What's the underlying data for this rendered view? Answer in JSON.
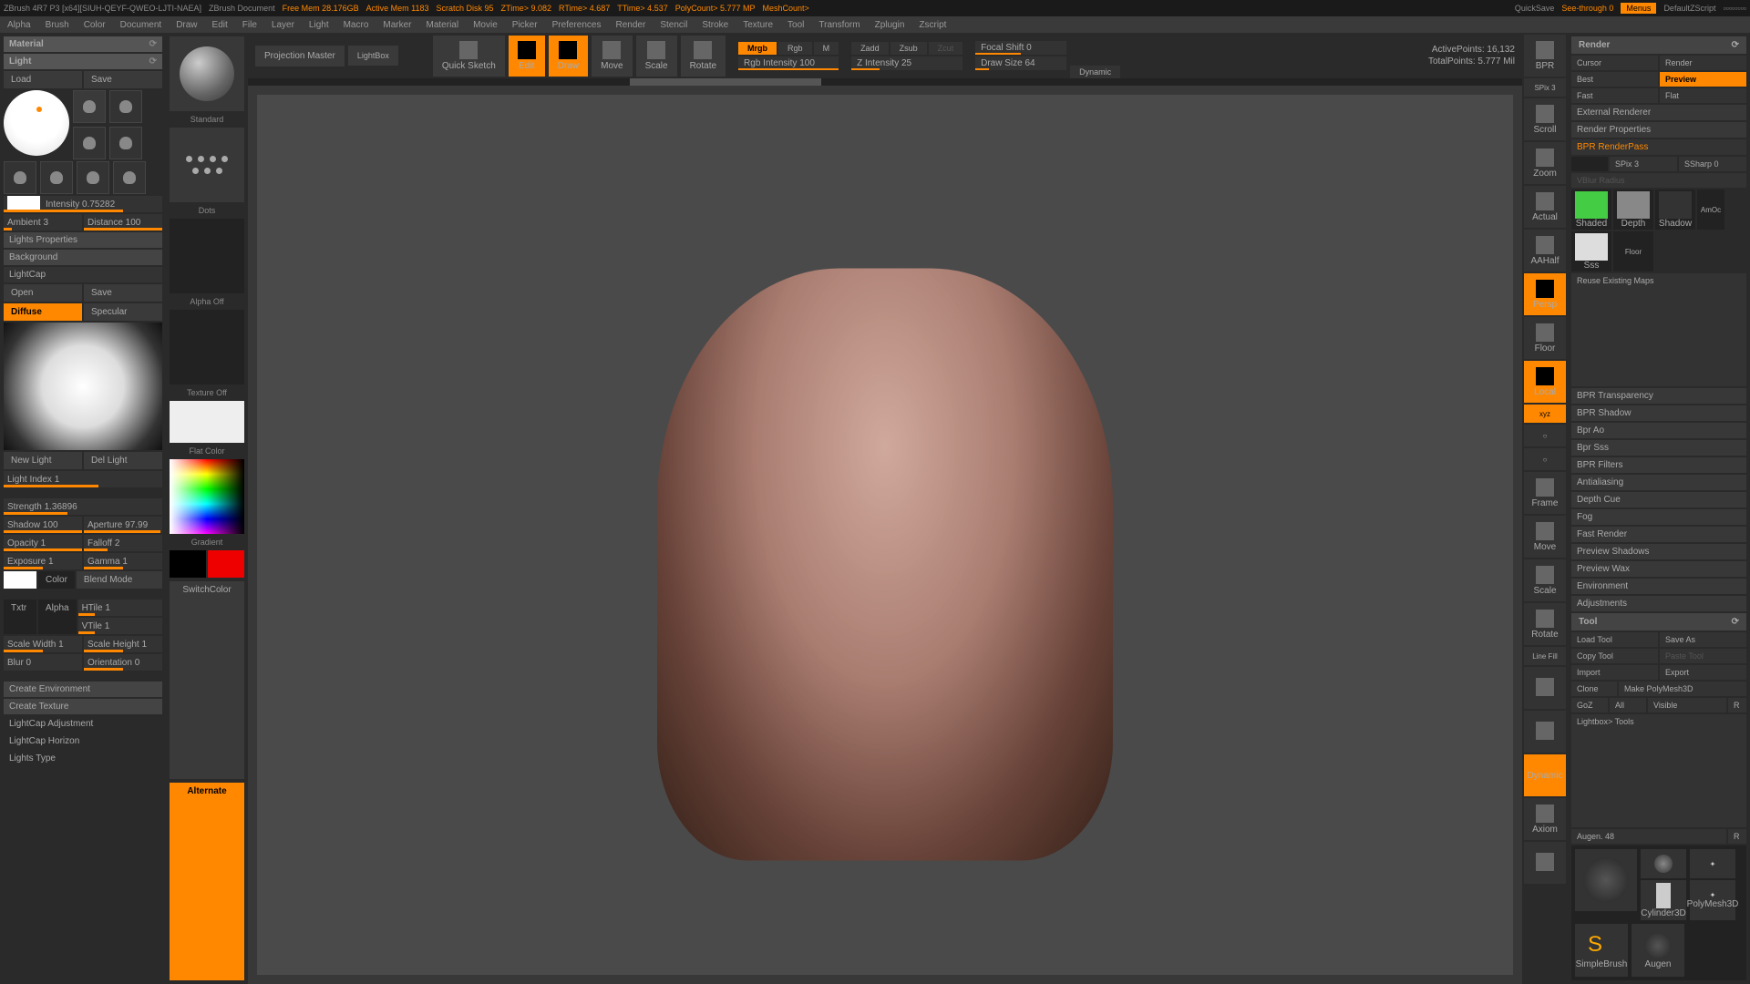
{
  "titlebar": {
    "app": "ZBrush 4R7 P3 [x64][SIUH-QEYF-QWEO-LJTI-NAEA]",
    "doc": "ZBrush Document",
    "freemem": "Free Mem 28.176GB",
    "activemem": "Active Mem 1183",
    "scratch": "Scratch Disk 95",
    "ztime": "ZTime> 9.082",
    "rtime": "RTime> 4.687",
    "ttime": "TTime> 4.537",
    "polycount": "PolyCount> 5.777 MP",
    "meshcount": "MeshCount>",
    "quicksave": "QuickSave",
    "seethrough": "See-through 0",
    "menus": "Menus",
    "script": "DefaultZScript"
  },
  "menubar": [
    "Alpha",
    "Brush",
    "Color",
    "Document",
    "Draw",
    "Edit",
    "File",
    "Layer",
    "Light",
    "Macro",
    "Marker",
    "Material",
    "Movie",
    "Picker",
    "Preferences",
    "Render",
    "Stencil",
    "Stroke",
    "Texture",
    "Tool",
    "Transform",
    "Zplugin",
    "Zscript"
  ],
  "leftpanel": {
    "material": "Material",
    "light": "Light",
    "load": "Load",
    "save": "Save",
    "intensity": "Intensity 0.75282",
    "ambient": "Ambient 3",
    "distance": "Distance 100",
    "lights_props": "Lights Properties",
    "background": "Background",
    "lightcap": "LightCap",
    "open": "Open",
    "save2": "Save",
    "diffuse": "Diffuse",
    "specular": "Specular",
    "newlight": "New Light",
    "dellight": "Del Light",
    "lightindex": "Light Index 1",
    "strength": "Strength 1.36896",
    "shadow": "Shadow 100",
    "aperture": "Aperture 97.99",
    "opacity": "Opacity 1",
    "falloff": "Falloff 2",
    "exposure": "Exposure 1",
    "gamma": "Gamma 1",
    "color": "Color",
    "blendmode": "Blend Mode",
    "htile": "HTile 1",
    "txtr": "Txtr",
    "alpha": "Alpha",
    "vtile": "VTile 1",
    "scalew": "Scale Width 1",
    "scaleh": "Scale Height 1",
    "blur": "Blur 0",
    "orient": "Orientation 0",
    "createenv": "Create Environment",
    "createtex": "Create Texture",
    "lcadjust": "LightCap Adjustment",
    "lchorizon": "LightCap Horizon",
    "lightstype": "Lights Type"
  },
  "toolcol": {
    "standard": "Standard",
    "dots": "Dots",
    "alphaoff": "Alpha Off",
    "textureoff": "Texture Off",
    "flatcolor": "Flat Color",
    "gradient": "Gradient",
    "switchcolor": "SwitchColor",
    "alternate": "Alternate"
  },
  "toolbar": {
    "projmaster": "Projection Master",
    "lightbox": "LightBox",
    "quicksketch": "Quick Sketch",
    "edit": "Edit",
    "draw": "Draw",
    "move": "Move",
    "scale": "Scale",
    "rotate": "Rotate",
    "mrgb": "Mrgb",
    "rgb": "Rgb",
    "m": "M",
    "rgbint": "Rgb Intensity 100",
    "zadd": "Zadd",
    "zsub": "Zsub",
    "zcut": "Zcut",
    "zint": "Z Intensity 25",
    "focalshift": "Focal Shift 0",
    "drawsize": "Draw Size 64",
    "dynamic": "Dynamic",
    "activepoints": "ActivePoints: 16,132",
    "totalpoints": "TotalPoints: 5.777 Mil"
  },
  "righttools": [
    "BPR",
    "SPix 3",
    "",
    "Scroll",
    "",
    "Zoom",
    "",
    "Actual",
    "",
    "AAHalf",
    "Dynamic",
    "Persp",
    "",
    "Floor",
    "",
    "Local",
    "xyz",
    "",
    "",
    "",
    "Frame",
    "",
    "Move",
    "",
    "Scale",
    "",
    "Rotate",
    "Line Fill",
    "",
    "",
    "",
    "Dynamic",
    "",
    "Axiom",
    "",
    "",
    "",
    ""
  ],
  "rightpanel": {
    "render": "Render",
    "cursor": "Cursor",
    "renderbtn": "Render",
    "best": "Best",
    "preview": "Preview",
    "fast": "Fast",
    "flat": "Flat",
    "extrender": "External Renderer",
    "renderprops": "Render Properties",
    "bprpass": "BPR RenderPass",
    "spix": "SPix 3",
    "ssharp": "SSharp 0",
    "vblur": "VBlur Radius",
    "shaded": "Shaded",
    "depth": "Depth",
    "shadow": "Shadow",
    "amoc": "AmOc",
    "sss": "Sss",
    "floor": "Floor",
    "reusemaps": "Reuse Existing Maps",
    "bprtrans": "BPR Transparency",
    "bprshadow": "BPR Shadow",
    "bprao": "Bpr Ao",
    "bprsss": "Bpr Sss",
    "bprfilters": "BPR Filters",
    "antialiasing": "Antialiasing",
    "depthcue": "Depth Cue",
    "fog": "Fog",
    "fastrender": "Fast Render",
    "prevshadows": "Preview Shadows",
    "prevwax": "Preview Wax",
    "environment": "Environment",
    "adjustments": "Adjustments",
    "tool": "Tool",
    "loadtool": "Load Tool",
    "saveas": "Save As",
    "copytool": "Copy Tool",
    "pastetool": "Paste Tool",
    "import": "Import",
    "export": "Export",
    "clone": "Clone",
    "makepm3d": "Make PolyMesh3D",
    "goz": "GoZ",
    "all": "All",
    "visible": "Visible",
    "r": "R",
    "lbtools": "Lightbox> Tools",
    "augen": "Augen. 48",
    "simplebrush": "SimpleBrush",
    "augenlbl": "Augen",
    "cylinder": "Cylinder3D",
    "polymesh": "PolyMesh3D"
  }
}
